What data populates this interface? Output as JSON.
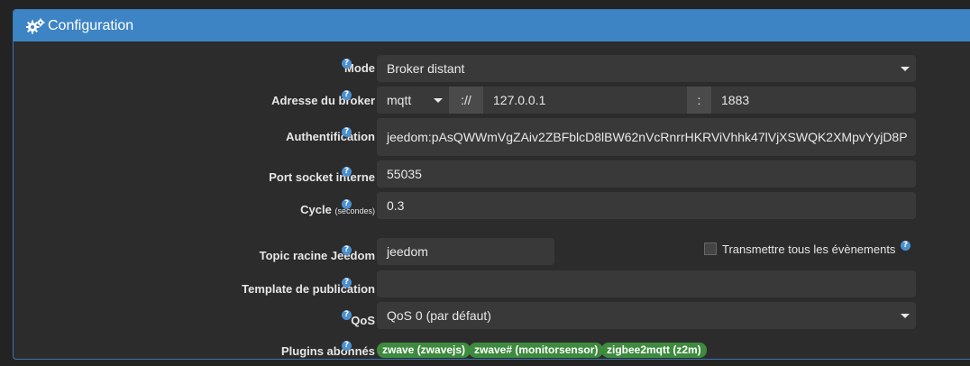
{
  "panel": {
    "title": "Configuration",
    "icon": "cogs-icon",
    "header_color": "#3d84c4"
  },
  "fields": {
    "mode": {
      "label": "Mode",
      "value": "Broker distant"
    },
    "broker": {
      "label": "Adresse du broker",
      "protocol": "mqtt",
      "separator": "://",
      "host": "127.0.0.1",
      "port_separator": ":",
      "port": "1883"
    },
    "auth": {
      "label": "Authentification",
      "value": "jeedom:pAsQWWmVgZAiv2ZBFblcD8lBW62nVcRnrrHKRViVhhk47lVjXSWQK2XMpvYyjD8P"
    },
    "socket": {
      "label": "Port socket interne",
      "value": "55035"
    },
    "cycle": {
      "label": "Cycle",
      "unit": "(secondes)",
      "value": "0.3"
    },
    "topic": {
      "label": "Topic racine Jeedom",
      "value": "jeedom"
    },
    "transmit": {
      "label": "Transmettre tous les évènements",
      "checked": false
    },
    "template": {
      "label": "Template de publication",
      "value": ""
    },
    "qos": {
      "label": "QoS",
      "value": "QoS 0 (par défaut)"
    },
    "plugins": {
      "label": "Plugins abonnés",
      "items": [
        "zwave (zwavejs)",
        "zwave# (monitorsensor)",
        "zigbee2mqtt (z2m)"
      ],
      "badge_color": "#3e8a3e"
    }
  },
  "help_symbol": "?"
}
